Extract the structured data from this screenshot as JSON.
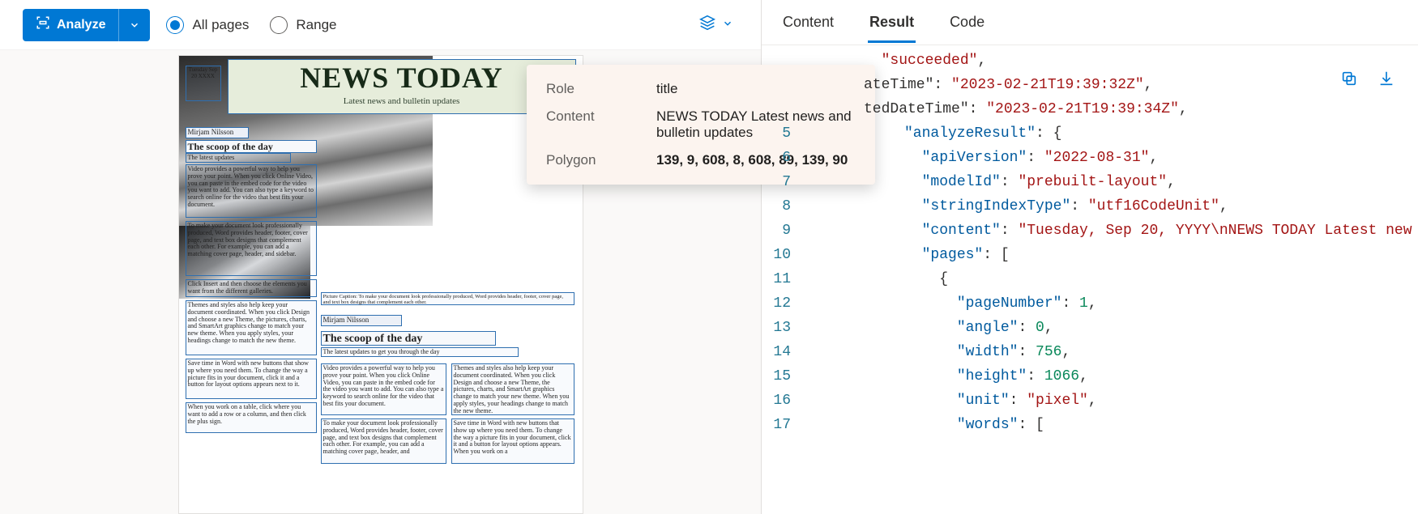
{
  "toolbar": {
    "analyze_label": "Analyze",
    "radio_all_pages": "All pages",
    "radio_range": "Range"
  },
  "tooltip": {
    "role_label": "Role",
    "role_value": "title",
    "content_label": "Content",
    "content_value": "NEWS TODAY Latest news and bulletin updates",
    "polygon_label": "Polygon",
    "polygon_value": "139, 9, 608, 8, 608, 89, 139, 90"
  },
  "tabs": {
    "content": "Content",
    "result": "Result",
    "code": "Code"
  },
  "doc": {
    "title": "NEWS TODAY",
    "subtitle": "Latest news and bulletin updates",
    "date": "Tuesday Sep 20 XXXX",
    "author1": "Mirjam Nilsson",
    "scoop1": "The scoop of the day",
    "updates1": "The latest updates",
    "para1": "Video provides a powerful way to help you prove your point. When you click Online Video, you can paste in the embed code for the video you want to add. You can also type a keyword to search online for the video that best fits your document.",
    "para2": "To make your document look professionally produced, Word provides header, footer, cover page, and text box designs that complement each other. For example, you can add a matching cover page, header, and sidebar.",
    "para3": "Click Insert and then choose the elements you want from the different galleries.",
    "caption": "Picture Caption: To make your document look professionally produced, Word provides header, footer, cover page, and text box designs that complement each other.",
    "para4": "Themes and styles also help keep your document coordinated. When you click Design and choose a new Theme, the pictures, charts, and SmartArt graphics change to match your new theme. When you apply styles, your headings change to match the new theme.",
    "author2": "Mirjam Nilsson",
    "scoop2": "The scoop of the day",
    "updates2": "The latest updates to get you through the day",
    "para5": "Save time in Word with new buttons that show up where you need them. To change the way a picture fits in your document, click it and a button for layout options appears next to it.",
    "para6": "Video provides a powerful way to help you prove your point. When you click Online Video, you can paste in the embed code for the video you want to add. You can also type a keyword to search online for the video that best fits your document.",
    "para7": "Themes and styles also help keep your document coordinated. When you click Design and choose a new Theme, the pictures, charts, and SmartArt graphics change to match your new theme. When you apply styles, your headings change to match the new theme.",
    "para8": "When you work on a table, click where you want to add a row or a column, and then click the plus sign.",
    "para9": "To make your document look professionally produced, Word provides header, footer, cover page, and text box designs that complement each other. For example, you can add a matching cover page, header, and",
    "para10": "Save time in Word with new buttons that show up where you need them. To change the way a picture fits in your document, click it and a button for layout options appears. When you work on a"
  },
  "code_lines": [
    {
      "n": "",
      "partial_key": "",
      "frag": "  <span class='tok-str'>\"succeeded\"</span><span class='tok-punc'>,</span>"
    },
    {
      "n": "",
      "frag": "<span class='partial-left'>ateTime\"</span><span class='tok-punc'>: </span><span class='tok-str'>\"2023-02-21T19:39:32Z\"</span><span class='tok-punc'>,</span>"
    },
    {
      "n": "",
      "frag": "<span class='partial-left'>tedDateTime\"</span><span class='tok-punc'>: </span><span class='tok-str'>\"2023-02-21T19:39:34Z\"</span><span class='tok-punc'>,</span>"
    },
    {
      "n": "5",
      "frag": "<span class='tok-key'>\"analyzeResult\"</span><span class='tok-punc'>: </span><span class='tok-brace'>{</span>"
    },
    {
      "n": "6",
      "frag": "  <span class='tok-key'>\"apiVersion\"</span><span class='tok-punc'>: </span><span class='tok-str'>\"2022-08-31\"</span><span class='tok-punc'>,</span>"
    },
    {
      "n": "7",
      "frag": "  <span class='tok-key'>\"modelId\"</span><span class='tok-punc'>: </span><span class='tok-str'>\"prebuilt-layout\"</span><span class='tok-punc'>,</span>"
    },
    {
      "n": "8",
      "frag": "  <span class='tok-key'>\"stringIndexType\"</span><span class='tok-punc'>: </span><span class='tok-str'>\"utf16CodeUnit\"</span><span class='tok-punc'>,</span>"
    },
    {
      "n": "9",
      "frag": "  <span class='tok-key'>\"content\"</span><span class='tok-punc'>: </span><span class='tok-str'>\"Tuesday, Sep 20, YYYY\\nNEWS TODAY Latest new</span>"
    },
    {
      "n": "10",
      "frag": "  <span class='tok-key'>\"pages\"</span><span class='tok-punc'>: </span><span class='tok-brace'>[</span>"
    },
    {
      "n": "11",
      "frag": "    <span class='tok-brace'>{</span>"
    },
    {
      "n": "12",
      "frag": "      <span class='tok-key'>\"pageNumber\"</span><span class='tok-punc'>: </span><span class='tok-num'>1</span><span class='tok-punc'>,</span>"
    },
    {
      "n": "13",
      "frag": "      <span class='tok-key'>\"angle\"</span><span class='tok-punc'>: </span><span class='tok-num'>0</span><span class='tok-punc'>,</span>"
    },
    {
      "n": "14",
      "frag": "      <span class='tok-key'>\"width\"</span><span class='tok-punc'>: </span><span class='tok-num'>756</span><span class='tok-punc'>,</span>"
    },
    {
      "n": "15",
      "frag": "      <span class='tok-key'>\"height\"</span><span class='tok-punc'>: </span><span class='tok-num'>1066</span><span class='tok-punc'>,</span>"
    },
    {
      "n": "16",
      "frag": "      <span class='tok-key'>\"unit\"</span><span class='tok-punc'>: </span><span class='tok-str'>\"pixel\"</span><span class='tok-punc'>,</span>"
    },
    {
      "n": "17",
      "frag": "      <span class='tok-key'>\"words\"</span><span class='tok-punc'>: </span><span class='tok-brace'>[</span>"
    }
  ]
}
